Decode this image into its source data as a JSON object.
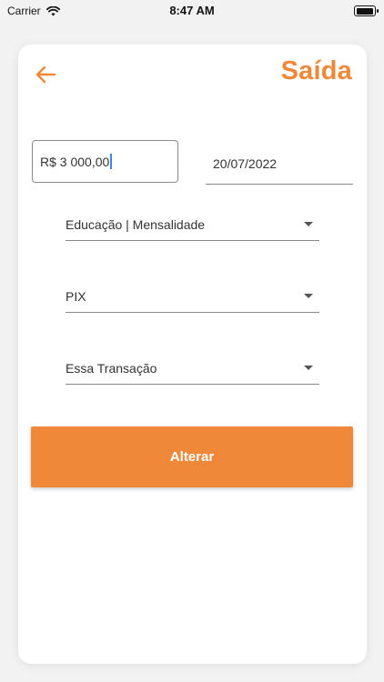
{
  "status_bar": {
    "carrier": "Carrier",
    "time": "8:47 AM",
    "battery_level": 0.9
  },
  "header": {
    "title": "Saída",
    "back_icon": "arrow-left-icon"
  },
  "form": {
    "amount_value": "R$ 3 000,00",
    "date_value": "20/07/2022",
    "category_value": "Educação | Mensalidade",
    "payment_method_value": "PIX",
    "scope_value": "Essa Transação",
    "submit_label": "Alterar"
  },
  "colors": {
    "accent": "#f0883a",
    "caret": "#3b82f6"
  }
}
